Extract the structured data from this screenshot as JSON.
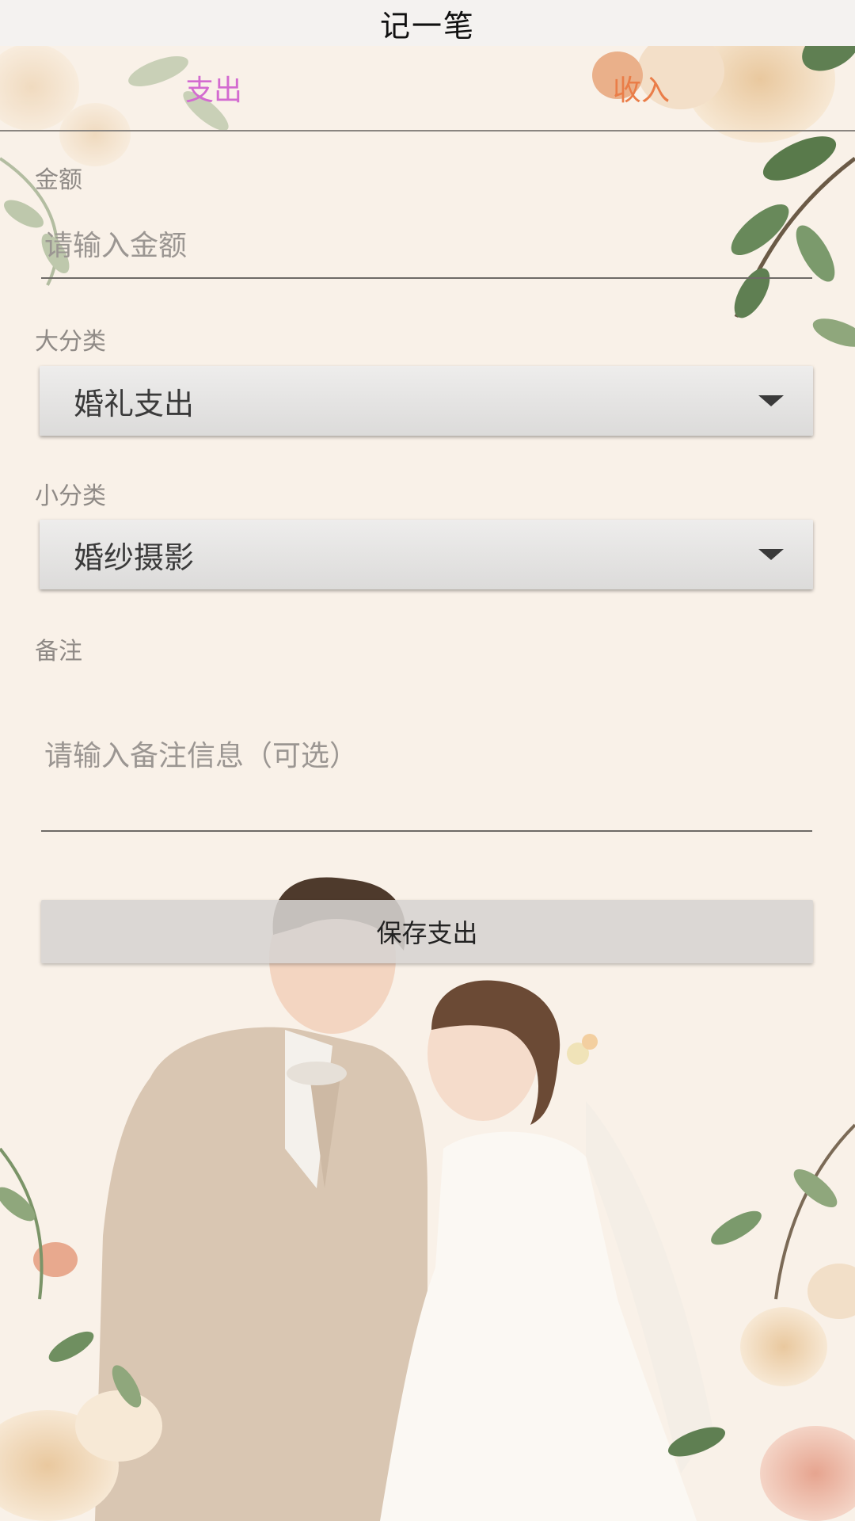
{
  "app": {
    "title": "记一笔"
  },
  "tabs": [
    {
      "label": "支出",
      "color": "#d36bd0",
      "active": true
    },
    {
      "label": "收入",
      "color": "#ea7d48",
      "active": false
    }
  ],
  "form": {
    "amount": {
      "label": "金额",
      "placeholder": "请输入金额",
      "value": ""
    },
    "main_category": {
      "label": "大分类",
      "selected": "婚礼支出"
    },
    "sub_category": {
      "label": "小分类",
      "selected": "婚纱摄影"
    },
    "note": {
      "label": "备注",
      "placeholder": "请输入备注信息（可选）",
      "value": ""
    },
    "save_label": "保存支出"
  },
  "icons": {
    "dropdown": "chevron-down-icon"
  }
}
